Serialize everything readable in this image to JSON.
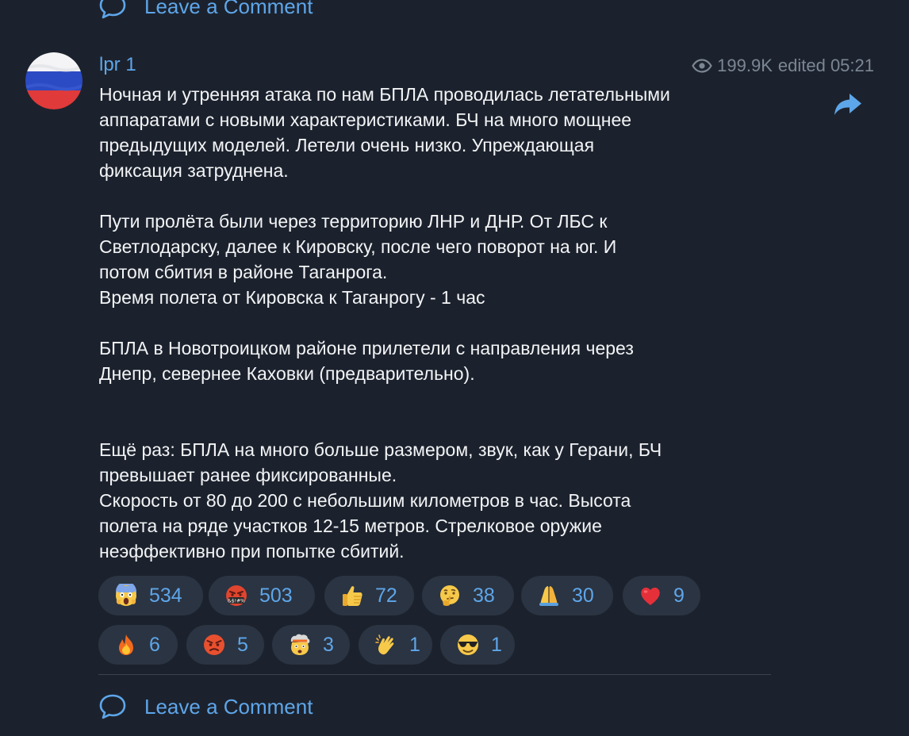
{
  "comment_top": {
    "label": "Leave a Comment",
    "icon": "comment-bubble-icon"
  },
  "post": {
    "author": "lpr 1",
    "views": "199.9K",
    "edited": "edited 05:21",
    "avatar": "russian-flag-avatar",
    "share_icon": "share-arrow-icon",
    "lines": [
      "Ночная и утренняя атака по нам БПЛА проводилась летательными",
      "аппаратами с новыми характеристиками. БЧ на много мощнее",
      "предыдущих моделей. Летели очень низко. Упреждающая",
      "фиксация затруднена.",
      "",
      "Пути пролёта были через территорию ЛНР и ДНР. От ЛБС к",
      "Светлодарску, далее к Кировску, после чего поворот на юг. И",
      "потом сбития в районе Таганрога.",
      "Время полета от Кировска к Таганрогу - 1 час",
      "",
      "БПЛА в Новотроицком районе прилетели с направления через",
      "Днепр, севернее Каховки (предварительно).",
      "",
      "",
      "Ещё раз: БПЛА на много больше размером, звук, как у Герани, БЧ",
      "превышает ранее фиксированные.",
      "Скорость от 80 до 200 с небольшим километров в час. Высота",
      "полета на ряде участков 12-15 метров. Стрелковое оружие",
      "неэффективно при попытке сбитий."
    ]
  },
  "reactions": [
    {
      "emoji": "screaming-face-emoji",
      "count": "534"
    },
    {
      "emoji": "cursing-face-emoji",
      "count": "503"
    },
    {
      "emoji": "thumbs-up-emoji",
      "count": "72"
    },
    {
      "emoji": "thinking-face-emoji",
      "count": "38"
    },
    {
      "emoji": "folded-hands-emoji",
      "count": "30"
    },
    {
      "emoji": "red-heart-emoji",
      "count": "9"
    },
    {
      "emoji": "fire-emoji",
      "count": "6"
    },
    {
      "emoji": "angry-face-emoji",
      "count": "5"
    },
    {
      "emoji": "exploding-head-emoji",
      "count": "3"
    },
    {
      "emoji": "clapping-hands-emoji",
      "count": "1"
    },
    {
      "emoji": "sunglasses-face-emoji",
      "count": "1"
    }
  ],
  "comment_bottom": {
    "label": "Leave a Comment",
    "icon": "comment-bubble-icon"
  },
  "colors": {
    "background": "#1c222d",
    "accent": "#5ea6ea",
    "text": "#f2f4f6",
    "muted": "#7b8694",
    "chip": "#2b3442"
  }
}
